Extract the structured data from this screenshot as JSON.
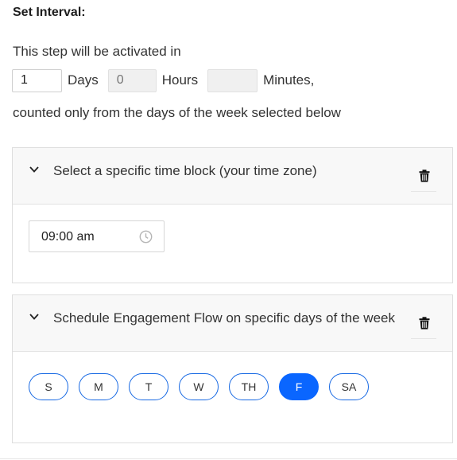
{
  "interval": {
    "title": "Set Interval:",
    "intro": "This step will be activated in",
    "days_value": "1",
    "days_label": "Days",
    "hours_placeholder": "0",
    "hours_label": "Hours",
    "minutes_value": "",
    "minutes_label": "Minutes,",
    "note": "counted only from the days of the week selected below"
  },
  "time_block": {
    "label": "Select a specific time block (your time zone)",
    "time_value": "09:00 am",
    "icons": [
      "chevron-down-icon",
      "trash-icon",
      "clock-icon"
    ]
  },
  "schedule": {
    "label": "Schedule Engagement Flow on specific days of the week",
    "days": [
      "S",
      "M",
      "T",
      "W",
      "TH",
      "F",
      "SA"
    ],
    "selected_day": "F",
    "accent_color": "#0a66ff",
    "icons": [
      "chevron-down-icon",
      "trash-icon"
    ]
  }
}
